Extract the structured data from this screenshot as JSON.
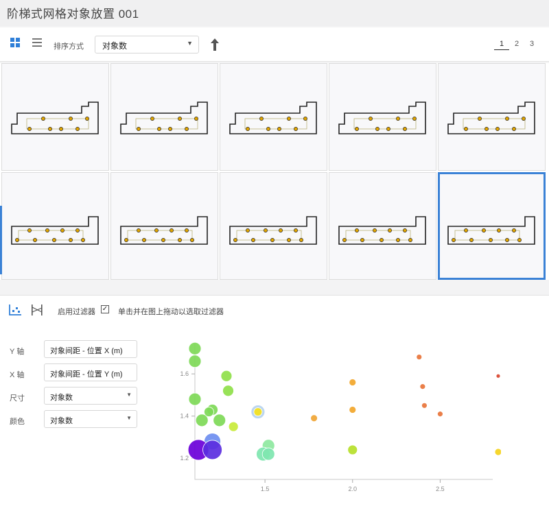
{
  "window": {
    "title": "阶梯式网格对象放置 001"
  },
  "toolbar": {
    "grid_view_icon": "grid-view-icon",
    "list_view_icon": "list-view-icon",
    "sort_label": "排序方式",
    "sort_value": "对象数",
    "sort_direction_icon": "arrow-up-icon",
    "pages": [
      "1",
      "2",
      "3"
    ],
    "active_page": "1"
  },
  "accent_color": "#3b82d6",
  "grid": {
    "selected_index": 9,
    "thumbnails": [
      {
        "variant": "3-top-3-bottom"
      },
      {
        "variant": "3-top-3-bottom"
      },
      {
        "variant": "3-top-3-bottom"
      },
      {
        "variant": "3-top-3-bottom"
      },
      {
        "variant": "3-top-3-bottom"
      },
      {
        "variant": "4-top-4-bottom"
      },
      {
        "variant": "4-top-4-bottom"
      },
      {
        "variant": "4-top-4-bottom"
      },
      {
        "variant": "4-top-4-bottom"
      },
      {
        "variant": "4-top-4-bottom"
      }
    ]
  },
  "analysis": {
    "scatter_tool_icon": "scatter-plot-icon",
    "parallel_tool_icon": "parallel-coordinates-icon",
    "enable_filter_label": "启用过滤器",
    "enable_filter_checked": "✓",
    "hint": "单击并在图上拖动以选取过滤器",
    "fields": [
      {
        "label": "Y 轴",
        "value": "对象间距 - 位置 X (m)"
      },
      {
        "label": "X 轴",
        "value": "对象间距 - 位置 Y (m)"
      },
      {
        "label": "尺寸",
        "value": "对象数"
      },
      {
        "label": "颜色",
        "value": "对象数"
      }
    ]
  },
  "chart_data": {
    "type": "scatter",
    "x_ticks": [
      "1.5",
      "2.0",
      "2.5"
    ],
    "y_ticks": [
      "1.2",
      "1.4",
      "1.6"
    ],
    "xlim": [
      1.1,
      2.8
    ],
    "ylim": [
      1.1,
      1.75
    ],
    "grid": false,
    "points": [
      {
        "x": 1.1,
        "y": 1.72,
        "size": 9,
        "color": "#7ed957"
      },
      {
        "x": 1.1,
        "y": 1.66,
        "size": 9,
        "color": "#7ed957"
      },
      {
        "x": 1.28,
        "y": 1.59,
        "size": 8,
        "color": "#8fe04a"
      },
      {
        "x": 1.29,
        "y": 1.52,
        "size": 8,
        "color": "#8fe04a"
      },
      {
        "x": 1.1,
        "y": 1.48,
        "size": 9,
        "color": "#7ed957"
      },
      {
        "x": 1.2,
        "y": 1.43,
        "size": 8,
        "color": "#7ed957"
      },
      {
        "x": 1.14,
        "y": 1.38,
        "size": 9,
        "color": "#7ed957"
      },
      {
        "x": 1.24,
        "y": 1.38,
        "size": 9,
        "color": "#7ed957"
      },
      {
        "x": 1.18,
        "y": 1.42,
        "size": 7,
        "color": "#7ed957"
      },
      {
        "x": 1.32,
        "y": 1.35,
        "size": 7,
        "color": "#c8ea3a"
      },
      {
        "x": 1.46,
        "y": 1.42,
        "size": 10,
        "color": "#b6d3ee"
      },
      {
        "x": 1.46,
        "y": 1.42,
        "size": 6,
        "color": "#f5e21b"
      },
      {
        "x": 1.2,
        "y": 1.28,
        "size": 12,
        "color": "#6e8ef0"
      },
      {
        "x": 1.12,
        "y": 1.24,
        "size": 15,
        "color": "#6a00d9"
      },
      {
        "x": 1.2,
        "y": 1.24,
        "size": 14,
        "color": "#5b2ee0"
      },
      {
        "x": 1.52,
        "y": 1.26,
        "size": 9,
        "color": "#8ee8a0"
      },
      {
        "x": 1.49,
        "y": 1.22,
        "size": 10,
        "color": "#7fe6b0"
      },
      {
        "x": 1.52,
        "y": 1.22,
        "size": 9,
        "color": "#7fe6b0"
      },
      {
        "x": 2.0,
        "y": 1.24,
        "size": 7,
        "color": "#b6e02a"
      },
      {
        "x": 2.0,
        "y": 1.56,
        "size": 5,
        "color": "#f2a62a"
      },
      {
        "x": 2.0,
        "y": 1.43,
        "size": 5,
        "color": "#f2a62a"
      },
      {
        "x": 1.78,
        "y": 1.39,
        "size": 5,
        "color": "#f0a534"
      },
      {
        "x": 2.38,
        "y": 1.68,
        "size": 4,
        "color": "#e8743a"
      },
      {
        "x": 2.4,
        "y": 1.54,
        "size": 4,
        "color": "#e8743a"
      },
      {
        "x": 2.41,
        "y": 1.45,
        "size": 4,
        "color": "#e8743a"
      },
      {
        "x": 2.5,
        "y": 1.41,
        "size": 4,
        "color": "#e8743a"
      },
      {
        "x": 2.85,
        "y": 1.59,
        "size": 3,
        "color": "#d9452f"
      },
      {
        "x": 2.84,
        "y": 1.23,
        "size": 5,
        "color": "#f5d21b"
      }
    ]
  }
}
